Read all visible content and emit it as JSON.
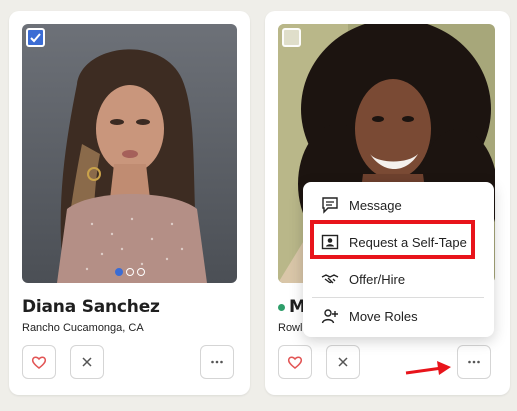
{
  "cards": [
    {
      "name": "Diana Sanchez",
      "location": "Rancho Cucamonga, CA",
      "selected": true,
      "photo_dots": 3,
      "active_photo": 1
    },
    {
      "name_visible": "M",
      "location_visible": "Rowl",
      "selected": false,
      "online": true
    }
  ],
  "context_menu": {
    "items": [
      {
        "label": "Message",
        "icon": "message-icon"
      },
      {
        "label": "Request a Self-Tape",
        "icon": "self-tape-icon"
      },
      {
        "label": "Offer/Hire",
        "icon": "handshake-icon"
      },
      {
        "label": "Move Roles",
        "icon": "person-add-icon"
      }
    ],
    "highlighted_item": "Request a Self-Tape"
  },
  "colors": {
    "accent": "#3b6cd4",
    "heart": "#e25555",
    "online": "#2e9e6a",
    "highlight": "#e8141b"
  }
}
